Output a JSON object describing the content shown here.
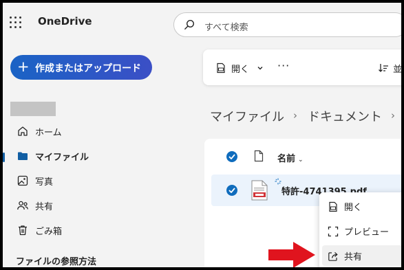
{
  "app": {
    "name": "OneDrive"
  },
  "search": {
    "placeholder": "すべて検索"
  },
  "create_button": {
    "label": "作成またはアップロード"
  },
  "sidebar": {
    "items": [
      {
        "label": "ホーム",
        "icon": "home-icon",
        "active": false
      },
      {
        "label": "マイファイル",
        "icon": "folder-icon",
        "active": true
      },
      {
        "label": "写真",
        "icon": "photo-icon",
        "active": false
      },
      {
        "label": "共有",
        "icon": "people-icon",
        "active": false
      },
      {
        "label": "ごみ箱",
        "icon": "trash-icon",
        "active": false
      }
    ],
    "section_title": "ファイルの参照方法"
  },
  "command_bar": {
    "open_label": "開く",
    "more_label": "···",
    "sort_label": "並"
  },
  "breadcrumb": {
    "items": [
      "マイファイル",
      "ドキュメント"
    ],
    "separator": "›"
  },
  "file_list": {
    "header": {
      "name_label": "名前"
    },
    "rows": [
      {
        "name": "特許-4741395.pdf",
        "selected": true
      }
    ]
  },
  "context_menu": {
    "items": [
      {
        "label": "開く",
        "icon": "pdf-open-icon"
      },
      {
        "label": "プレビュー",
        "icon": "preview-icon"
      },
      {
        "label": "共有",
        "icon": "share-icon",
        "highlighted": true
      }
    ]
  },
  "colors": {
    "accent": "#0f6cbd",
    "arrow": "#e0141e",
    "selected_row": "#ebf3fc"
  }
}
